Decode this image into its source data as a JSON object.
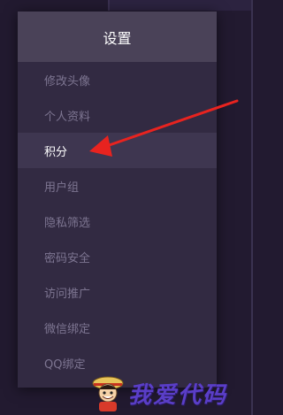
{
  "menu": {
    "title": "设置",
    "items": [
      {
        "label": "修改头像",
        "active": false
      },
      {
        "label": "个人资料",
        "active": false
      },
      {
        "label": "积分",
        "active": true
      },
      {
        "label": "用户组",
        "active": false
      },
      {
        "label": "隐私筛选",
        "active": false
      },
      {
        "label": "密码安全",
        "active": false
      },
      {
        "label": "访问推广",
        "active": false
      },
      {
        "label": "微信绑定",
        "active": false
      },
      {
        "label": "QQ绑定",
        "active": false
      }
    ]
  },
  "annotation": {
    "arrow_color": "#e8231f",
    "points_to": "积分"
  },
  "watermark": {
    "text": "我爱代码",
    "icon": "pirate-mascot-icon"
  },
  "colors": {
    "background": "#221a30",
    "menu_bg": "#322a42",
    "header_bg": "#4a4258",
    "active_bg": "#3e3650",
    "item_text": "#7d7591",
    "active_text": "#ffffff"
  }
}
